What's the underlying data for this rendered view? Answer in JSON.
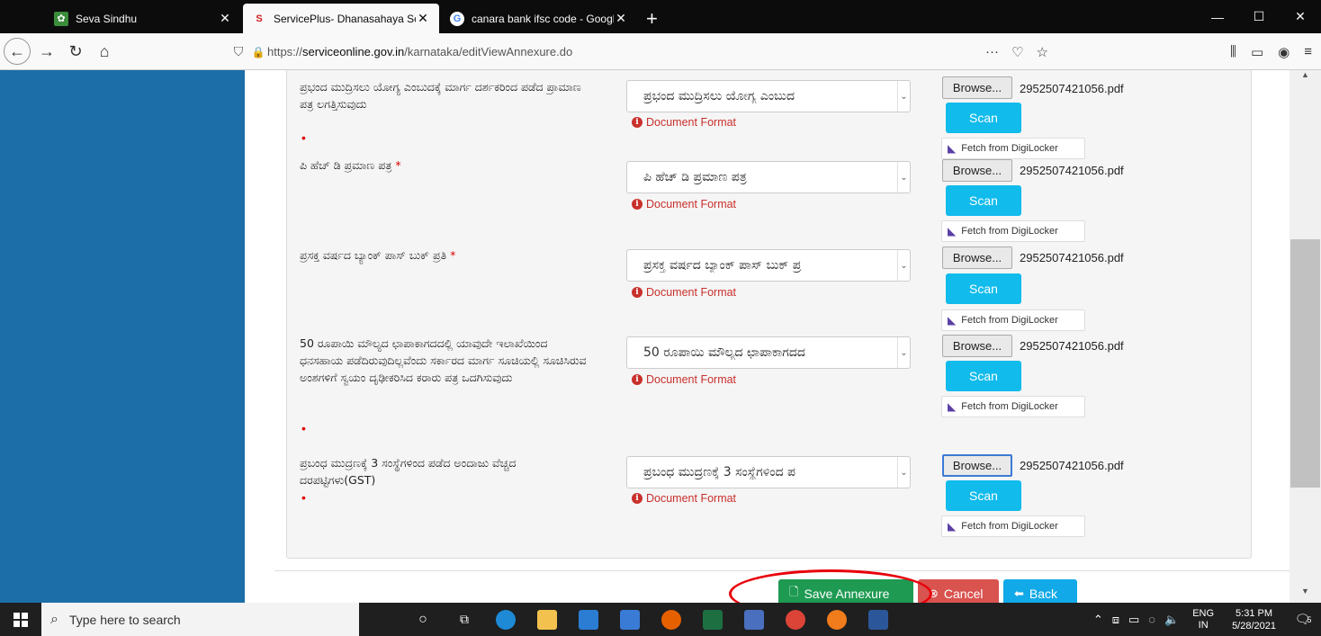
{
  "browser": {
    "tabs": [
      {
        "title": "Seva Sindhu",
        "favicon": "seva-sindhu-icon"
      },
      {
        "title": "ServicePlus- Dhanasahaya Sche",
        "favicon": "serviceplus-icon",
        "active": true
      },
      {
        "title": "canara bank ifsc code - Google",
        "favicon": "google-icon"
      }
    ],
    "new_tab": "+",
    "url_prefix": "https://",
    "url_host": "serviceonline.gov.in",
    "url_path": "/karnataka/editViewAnnexure.do",
    "url_more": "···",
    "window_controls": {
      "minimize": "—",
      "maximize": "☐",
      "close": "✕"
    }
  },
  "annexure": {
    "rows": [
      {
        "label": "ಪ್ರಭಂದ ಮುದ್ರಿಸಲು ಯೋಗ್ಯ ಎಂಬುದಕ್ಕೆ ಮಾರ್ಗ ದರ್ಶಕರಿಂದ ಪಡೆದ ಪ್ರಾಮಾಣ ಪತ್ರ ಲಗತ್ತಿಸುವುದು",
        "required_mark": "•",
        "selected": "ಪ್ರಭಂದ ಮುದ್ರಿಸಲು ಯೋಗ್ಯ ಎಂಬುದ",
        "format_hint": "Document Format",
        "browse": "Browse...",
        "file": "2952507421056.pdf",
        "scan": "Scan",
        "digilocker": "Fetch from DigiLocker"
      },
      {
        "label": "ಪಿ ಹೆಚ್ ಡಿ ಪ್ರಮಾಣ ಪತ್ರ",
        "required_mark": "*",
        "selected": "ಪಿ ಹೆಚ್ ಡಿ ಪ್ರಮಾಣ ಪತ್ರ",
        "format_hint": "Document Format",
        "browse": "Browse...",
        "file": "2952507421056.pdf",
        "scan": "Scan",
        "digilocker": "Fetch from DigiLocker"
      },
      {
        "label": "ಪ್ರಸಕ್ತ ವರ್ಷದ ಬ್ಯಾಂಕ್ ಪಾಸ್ ಬುಕ್ ಪ್ರತಿ",
        "required_mark": "*",
        "selected": "ಪ್ರಸಕ್ತ ವರ್ಷದ ಬ್ಯಾಂಕ್ ಪಾಸ್ ಬುಕ್ ಪ್ರ",
        "format_hint": "Document Format",
        "browse": "Browse...",
        "file": "2952507421056.pdf",
        "scan": "Scan",
        "digilocker": "Fetch from DigiLocker"
      },
      {
        "label": "50 ರೂಪಾಯಿ ಮೌಲ್ಯದ ಛಾಪಾಕಾಗದದಲ್ಲಿ ಯಾವುದೇ ಇಲಾಖೆಯಿಂದ ಧನಸಹಾಯ ಪಡೆದಿರುವುದಿಲ್ಲವೆಂದು ಸರ್ಕಾರದ ಮಾರ್ಗ ಸೂಚಿಯಲ್ಲಿ ಸೂಚಿಸಿರುವ ಅಂಶಗಳಿಗೆ ಸ್ವಯಂ ದೃಢೀಕರಿಸಿದ ಕರಾರು ಪತ್ರ ಒದಗಿಸುವುದು",
        "required_mark": "•",
        "selected": "50 ರೂಪಾಯಿ ಮೌಲ್ಯದ ಛಾಪಾಕಾಗದದ",
        "format_hint": "Document Format",
        "browse": "Browse...",
        "file": "2952507421056.pdf",
        "scan": "Scan",
        "digilocker": "Fetch from DigiLocker"
      },
      {
        "label": "ಪ್ರಬಂಧ ಮುದ್ರಣಕ್ಕೆ 3 ಸಂಸ್ಥೆಗಳಿಂದ ಪಡೆದ ಅಂದಾಜು ವೆಚ್ಚದ ದರಪಟ್ಟಿಗಳು(GST)",
        "required_mark": "•",
        "selected": "ಪ್ರಬಂಧ ಮುದ್ರಣಕ್ಕೆ 3 ಸಂಸ್ಥೆಗಳಿಂದ ಪ",
        "format_hint": "Document Format",
        "browse": "Browse...",
        "file": "2952507421056.pdf",
        "scan": "Scan",
        "digilocker": "Fetch from DigiLocker"
      }
    ],
    "actions": {
      "save": "Save Annexure",
      "cancel": "Cancel",
      "back": "Back"
    }
  },
  "taskbar": {
    "search_placeholder": "Type here to search",
    "lang_top": "ENG",
    "lang_bottom": "IN",
    "time": "5:31 PM",
    "date": "5/28/2021",
    "notifications": "5"
  },
  "colors": {
    "sidebar": "#1b6ea8",
    "scan": "#11bbec",
    "save": "#1e9a52",
    "cancel": "#d9534f",
    "back": "#11a9e8",
    "error": "#c9302c",
    "highlight": "#e8000b"
  }
}
